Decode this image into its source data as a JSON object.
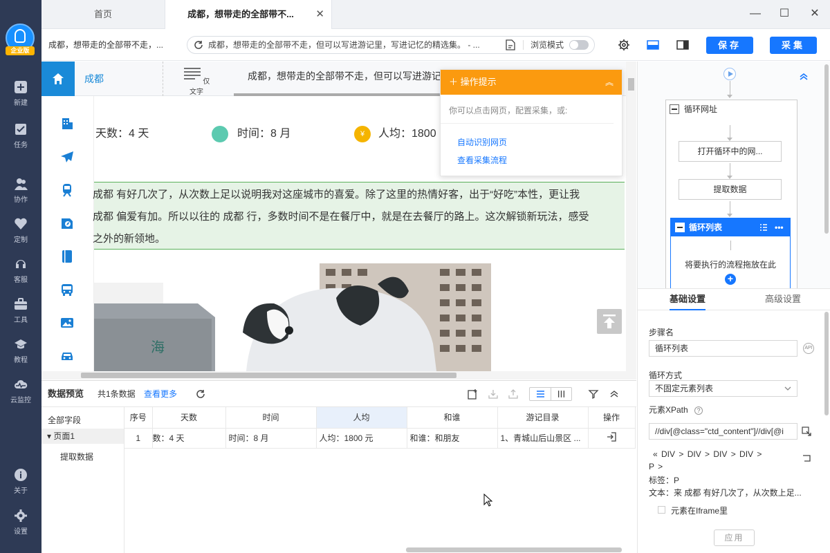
{
  "rail": {
    "logo_badge": "企业版",
    "items": [
      {
        "label": "新建",
        "icon": "plus-square-icon"
      },
      {
        "label": "任务",
        "icon": "task-check-icon"
      },
      {
        "label": "协作",
        "icon": "users-icon"
      },
      {
        "label": "定制",
        "icon": "heart-shield-icon"
      },
      {
        "label": "客服",
        "icon": "headset-icon"
      },
      {
        "label": "工具",
        "icon": "toolbox-icon"
      },
      {
        "label": "教程",
        "icon": "graduation-cap-icon"
      },
      {
        "label": "云监控",
        "icon": "cloud-pulse-icon"
      },
      {
        "label": "关于",
        "icon": "info-icon"
      },
      {
        "label": "设置",
        "icon": "gear-icon"
      }
    ]
  },
  "tabs": {
    "home": "首页",
    "active": "成都，想带走的全部带不...",
    "close": "✕"
  },
  "window": {
    "minimize": "—",
    "maximize": "☐",
    "close": "✕"
  },
  "toolbar": {
    "title": "成都，想带走的全部带不走，...",
    "url": "成都，想带走的全部带不走，但可以写进游记里，写进记忆的精选集。 - ...",
    "browse_mode": "浏览模式",
    "save_label": "保存",
    "collect_label": "采集"
  },
  "page": {
    "city": "成都",
    "text_only": "仅文字",
    "article_title": "成都，想带走的全部带不走，但可以写进游记里",
    "stats": {
      "days": "天数：4 天",
      "time": "时间：8 月",
      "avg": "人均：1800"
    },
    "paragraph": [
      "成都 有好几次了，从次数上足以说明我对这座城市的喜爱。除了这里的热情好客，出于“好吃”本性，更让我",
      "成都 偏爱有加。所以以往的 成都 行，多数时间不是在餐厅中，就是在去餐厅的路上。这次解锁新玩法，感受",
      "之外的新领地。"
    ],
    "photo_sign": "海"
  },
  "tip": {
    "title": "操作提示",
    "intro": "你可以点击网页，配置采集，或:",
    "link1": "自动识别网页",
    "link2": "查看采集流程"
  },
  "preview": {
    "title": "数据预览",
    "count": "共1条数据",
    "more": "查看更多",
    "all_fields": "全部字段",
    "page": "页面1",
    "extract": "提取数据",
    "columns": [
      "序号",
      "天数",
      "时间",
      "人均",
      "和谁",
      "游记目录",
      "操作"
    ],
    "rows": [
      [
        "1",
        "数：4 天",
        "时间：8 月",
        "人均：1800 元",
        "和谁：和朋友",
        "1、青城山后山景区 ...",
        ""
      ]
    ]
  },
  "flow": {
    "loop_url": "循环网址",
    "open_loop": "打开循环中的网...",
    "extract": "提取数据",
    "loop_list": "循环列表",
    "drop_hint": "将要执行的流程拖放在此"
  },
  "settings": {
    "tab_basic": "基础设置",
    "tab_advanced": "高级设置",
    "step_name_label": "步骤名",
    "step_name_value": "循环列表",
    "loop_mode_label": "循环方式",
    "loop_mode_value": "不固定元素列表",
    "xpath_label": "元素XPath",
    "xpath_value": "//div[@class=\"ctd_content\"]//div[@i",
    "crumbs": "«  DIV  >  DIV  >  DIV  >  DIV  >",
    "crumbs2": "P  >",
    "tag_line": "标签：P",
    "text_line": "文本：来 成都 有好几次了，从次数上足...",
    "iframe_label": "元素在Iframe里",
    "apply": "应用"
  },
  "colors": {
    "rail_bg": "#2e3a55",
    "accent": "#1677ff",
    "tip_orange": "#fb9a0f",
    "highlight_green": "#e6f3e6"
  }
}
